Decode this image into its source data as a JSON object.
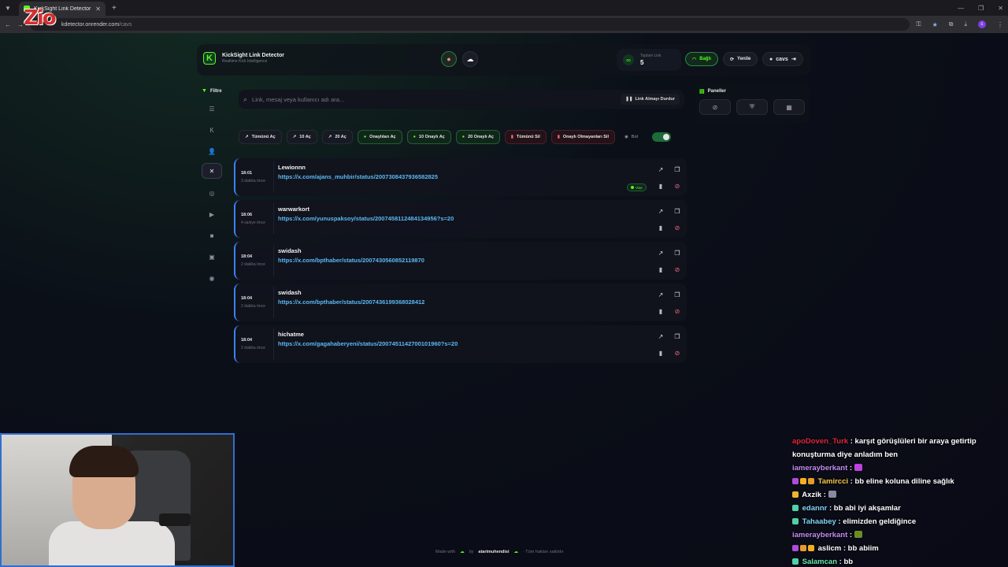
{
  "browser": {
    "tab_title": "KickSight Link Detector",
    "url_main": "kdetector.onrender.com",
    "url_path": "/cavs",
    "profile_initial": "c"
  },
  "overlay_logo": "Zio",
  "header": {
    "brand_title": "KickSight Link Detector",
    "brand_subtitle": "Realtime Kick Intelligence",
    "total_label": "Toplam Link",
    "total_value": "5",
    "connected_label": "Bağlı",
    "refresh_label": "Yenile",
    "user_label": "cavs"
  },
  "sidebar": {
    "filter_label": "Filtre"
  },
  "search": {
    "placeholder": "Link, mesaj veya kullanıcı adı ara...",
    "stop_label": "Link Almayı Durdur"
  },
  "panels": {
    "title": "Paneller"
  },
  "actions": {
    "open_all": "Tümünü Aç",
    "open_10": "10 Aç",
    "open_20": "20 Aç",
    "open_approved": "Onaylıları Aç",
    "open_10_approved": "10 Onaylı Aç",
    "open_20_approved": "20 Onaylı Aç",
    "delete_all": "Tümünü Sil",
    "delete_unapproved": "Onaylı Olmayanları Sil",
    "bot_label": "Bot"
  },
  "links": [
    {
      "time": "18:01",
      "ago": "3 dakika önce",
      "user": "Lewionnn",
      "url": "https://x.com/ajans_muhbir/status/2007308437936582825",
      "badge": "Vise"
    },
    {
      "time": "18:06",
      "ago": "4 saniye önce",
      "user": "warwarkort",
      "url": "https://x.com/yunuspaksoy/status/2007458112484134956?s=20",
      "badge": ""
    },
    {
      "time": "18:04",
      "ago": "2 dakika önce",
      "user": "swidash",
      "url": "https://x.com/bpthaber/status/2007430560852119870",
      "badge": ""
    },
    {
      "time": "18:04",
      "ago": "2 dakika önce",
      "user": "swidash",
      "url": "https://x.com/bpthaber/status/2007436199368028412",
      "badge": ""
    },
    {
      "time": "18:04",
      "ago": "2 dakika önce",
      "user": "hichatme",
      "url": "https://x.com/gagahaberyeni/status/2007451142700101960?s=20",
      "badge": ""
    }
  ],
  "footer": {
    "made_with": "Made with",
    "by": "by",
    "author": "atarimuhendisi",
    "rights": "· Tüm hakları saklıdır"
  },
  "chat": [
    {
      "user": "apoDoven_Turk",
      "color": "#e0263c",
      "text": ": karşıt görüşlüleri bir araya getirtip konuşturma diye anladım ben"
    },
    {
      "user": "iamerayberkant",
      "color": "#c28bf0",
      "text": ":"
    },
    {
      "user": "Tamircci",
      "color": "#f7c948",
      "text": ": bb eline koluna diline sağlık"
    },
    {
      "user": "Axzik",
      "color": "#ffffff",
      "text": ":"
    },
    {
      "user": "edannr",
      "color": "#7fd6f5",
      "text": ": bb abi iyi akşamlar"
    },
    {
      "user": "Tahaabey",
      "color": "#7fd6f5",
      "text": ": elimizden geldiğince"
    },
    {
      "user": "iamerayberkant",
      "color": "#c28bf0",
      "text": ":"
    },
    {
      "user": "aslicm",
      "color": "#ffffff",
      "text": ": bb abiim"
    },
    {
      "user": "Salamcan",
      "color": "#6ee7a8",
      "text": ": bb"
    }
  ],
  "colors": {
    "accent": "#53fc18",
    "link": "#5bb8f5",
    "danger": "#f06a7e",
    "card_border": "#3b82f6"
  }
}
